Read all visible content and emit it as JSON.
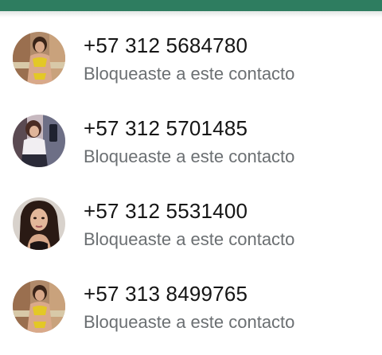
{
  "header": {
    "color": "#2e7d60"
  },
  "contacts": [
    {
      "phone": "+57 312 5684780",
      "status": "Bloqueaste a este contacto",
      "avatar_icon": "contact-photo-icon"
    },
    {
      "phone": "+57 312 5701485",
      "status": "Bloqueaste a este contacto",
      "avatar_icon": "contact-photo-icon"
    },
    {
      "phone": "+57 312 5531400",
      "status": "Bloqueaste a este contacto",
      "avatar_icon": "contact-photo-icon"
    },
    {
      "phone": "+57 313 8499765",
      "status": "Bloqueaste a este contacto",
      "avatar_icon": "contact-photo-icon"
    }
  ]
}
